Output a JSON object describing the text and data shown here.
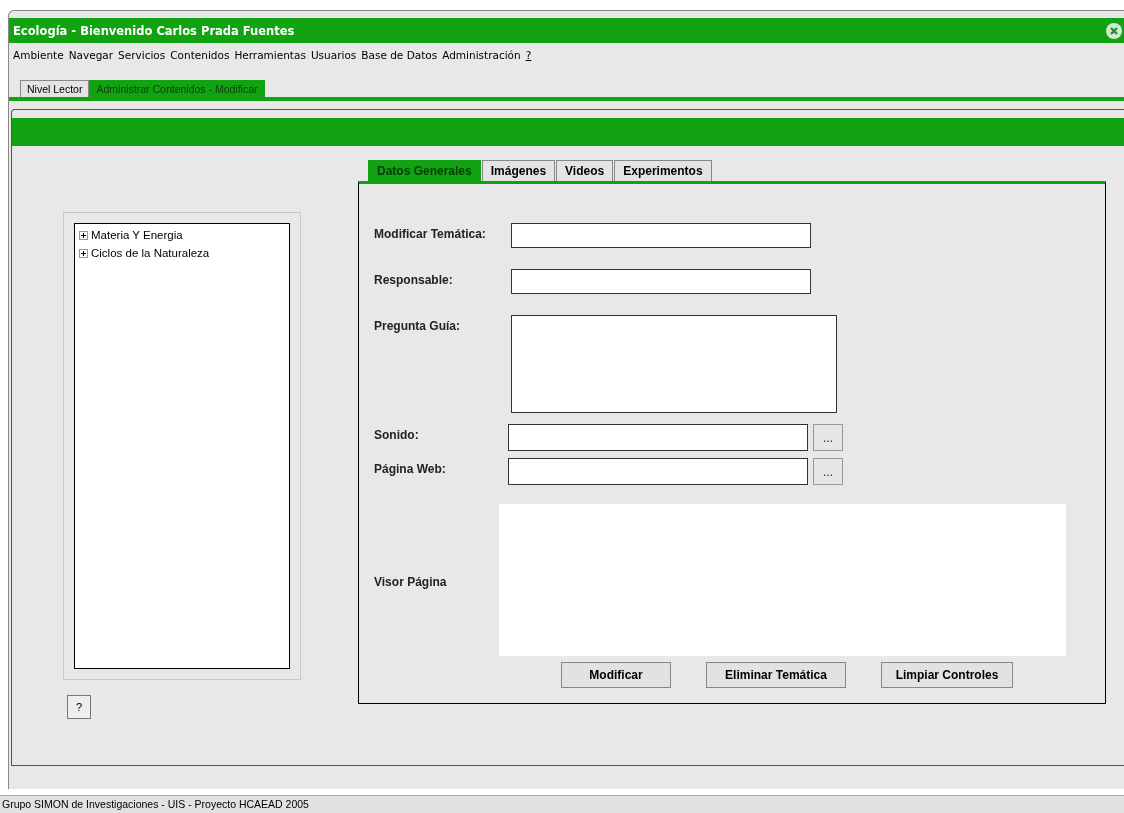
{
  "window": {
    "title": "Ecología - Bienvenido Carlos Prada Fuentes"
  },
  "menu": [
    "Ambiente",
    "Navegar",
    "Servicios",
    "Contenidos",
    "Herramientas",
    "Usuarios",
    "Base de Datos",
    "Administración",
    "?"
  ],
  "tabs": [
    {
      "label": "Nivel Lector",
      "selected": false
    },
    {
      "label": "Administrar Contenidos - Modificar",
      "selected": true
    }
  ],
  "tree": {
    "items": [
      {
        "label": "Materia Y Energia",
        "expanded": false
      },
      {
        "label": "Ciclos de la Naturaleza",
        "expanded": false
      }
    ]
  },
  "help_button": "?",
  "form_tabs": [
    {
      "label": "Datos Generales",
      "selected": true
    },
    {
      "label": "Imágenes",
      "selected": false
    },
    {
      "label": "Videos",
      "selected": false
    },
    {
      "label": "Experimentos",
      "selected": false
    }
  ],
  "fields": [
    {
      "kind": "text",
      "label": "Modificar Temática:"
    },
    {
      "kind": "text",
      "label": "Responsable:"
    },
    {
      "kind": "textarea",
      "label": "Pregunta Guía:"
    },
    {
      "kind": "file",
      "label": "Sonido:",
      "button": "..."
    },
    {
      "kind": "file",
      "label": "Página Web:",
      "button": "..."
    },
    {
      "kind": "viewer",
      "label": "Visor Página"
    }
  ],
  "buttons": [
    "Modificar",
    "Eliminar Temática",
    "Limpiar Controles"
  ],
  "status_bar": "Grupo SIMON de Investigaciones - UIS - Proyecto HCAEAD  2005"
}
